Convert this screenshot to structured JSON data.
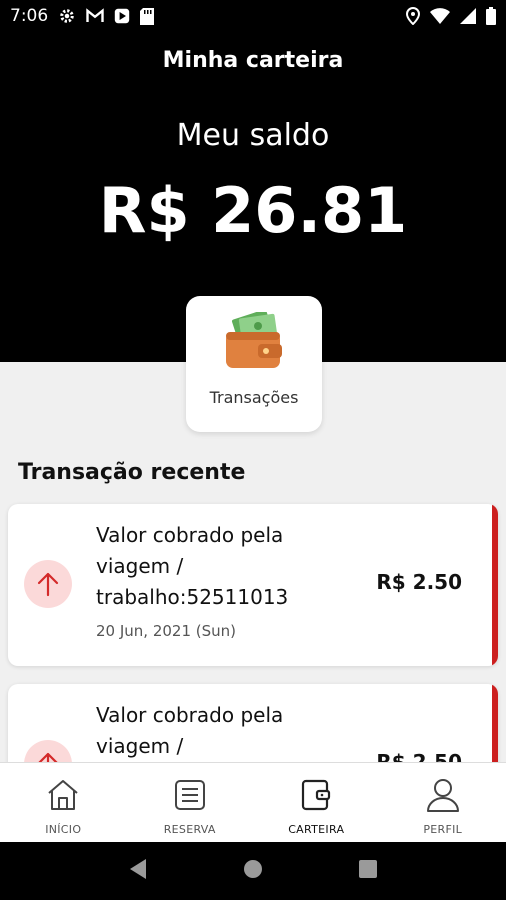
{
  "status_bar": {
    "time": "7:06"
  },
  "header": {
    "title": "Minha carteira",
    "balance_label": "Meu saldo",
    "balance_value": "R$ 26.81"
  },
  "transactions_tile": {
    "label": "Transações",
    "icon": "wallet-icon"
  },
  "recent": {
    "title": "Transação recente",
    "items": [
      {
        "description": "Valor cobrado pela viagem / trabalho:52511013",
        "date": "20 Jun, 2021 (Sun)",
        "amount": "R$ 2.50",
        "direction_icon": "arrow-up-icon"
      },
      {
        "description": "Valor cobrado pela viagem /",
        "date": "",
        "amount": "R$ 2.50",
        "direction_icon": "arrow-up-icon"
      }
    ]
  },
  "bottom_nav": {
    "items": [
      {
        "label": "INÍCIO",
        "icon": "home-icon"
      },
      {
        "label": "RESERVA",
        "icon": "list-icon"
      },
      {
        "label": "CARTEIRA",
        "icon": "wallet-icon"
      },
      {
        "label": "PERFIL",
        "icon": "user-icon"
      }
    ],
    "active": "CARTEIRA"
  },
  "colors": {
    "accent": "#cc1f1f",
    "header_bg": "#000000",
    "content_bg": "#f0f0f0"
  }
}
